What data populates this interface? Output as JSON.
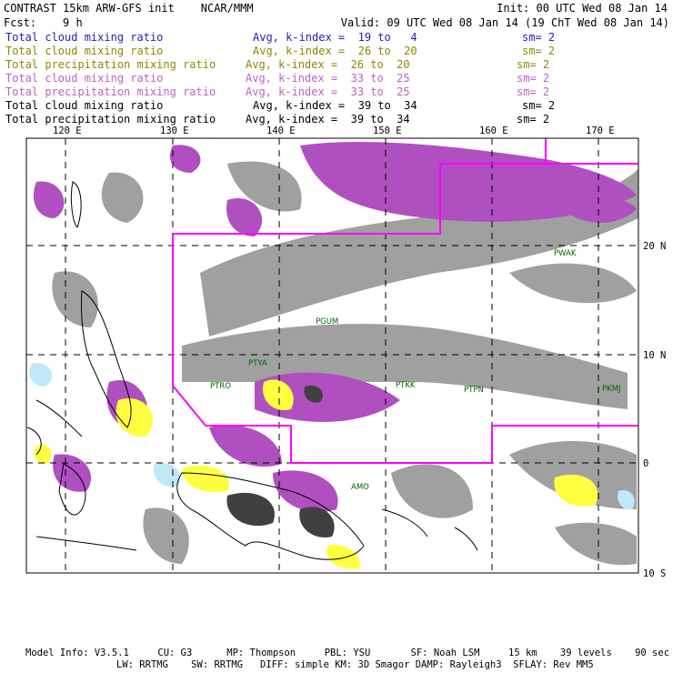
{
  "header": {
    "title": "CONTRAST 15km ARW-GFS init",
    "org": "NCAR/MMM",
    "init": "Init: 00 UTC Wed 08 Jan 14",
    "fcst_label": "Fcst:",
    "fcst_value": "9 h",
    "valid": "Valid: 09 UTC Wed 08 Jan 14 (19 ChT Wed 08 Jan 14)"
  },
  "fields": [
    {
      "name": "Total cloud mixing ratio",
      "avg": "Avg, k-index =  19 to   4",
      "sm": "sm= 2",
      "color": "#2020c0"
    },
    {
      "name": "Total cloud mixing ratio",
      "avg": "Avg, k-index =  26 to  20",
      "sm": "sm= 2",
      "color": "#8a8a00"
    },
    {
      "name": "Total precipitation mixing ratio",
      "avg": "Avg, k-index =  26 to  20",
      "sm": "sm= 2",
      "color": "#8a8a00"
    },
    {
      "name": "Total cloud mixing ratio",
      "avg": "Avg, k-index =  33 to  25",
      "sm": "sm= 2",
      "color": "#c060c0"
    },
    {
      "name": "Total precipitation mixing ratio",
      "avg": "Avg, k-index =  33 to  25",
      "sm": "sm= 2",
      "color": "#c060c0"
    },
    {
      "name": "Total cloud mixing ratio",
      "avg": "Avg, k-index =  39 to  34",
      "sm": "sm= 2",
      "color": "#000000"
    },
    {
      "name": "Total precipitation mixing ratio",
      "avg": "Avg, k-index =  39 to  34",
      "sm": "sm= 2",
      "color": "#000000"
    }
  ],
  "map": {
    "lon_labels": [
      "120 E",
      "130 E",
      "140 E",
      "150 E",
      "160 E",
      "170 E"
    ],
    "lat_labels": [
      "20 N",
      "10 N",
      "0",
      "10 S"
    ],
    "stations": [
      "PGUM",
      "PTYA",
      "PTRO",
      "PTKK",
      "PTPN",
      "PKMJ",
      "PWAK",
      "AMO"
    ],
    "colors": {
      "gray": "#a0a0a0",
      "purple": "#b050c0",
      "yellow": "#ffff40",
      "lightblue": "#c0e8f8",
      "magenta": "#ff00ff",
      "grid": "#000000"
    }
  },
  "footer": {
    "line1": "Model Info: V3.5.1     CU: G3      MP: Thompson     PBL: YSU       SF: Noah LSM     15 km    39 levels    90 sec",
    "line2": "LW: RRTMG    SW: RRTMG   DIFF: simple KM: 3D Smagor DAMP: Rayleigh3  SFLAY: Rev MM5"
  }
}
